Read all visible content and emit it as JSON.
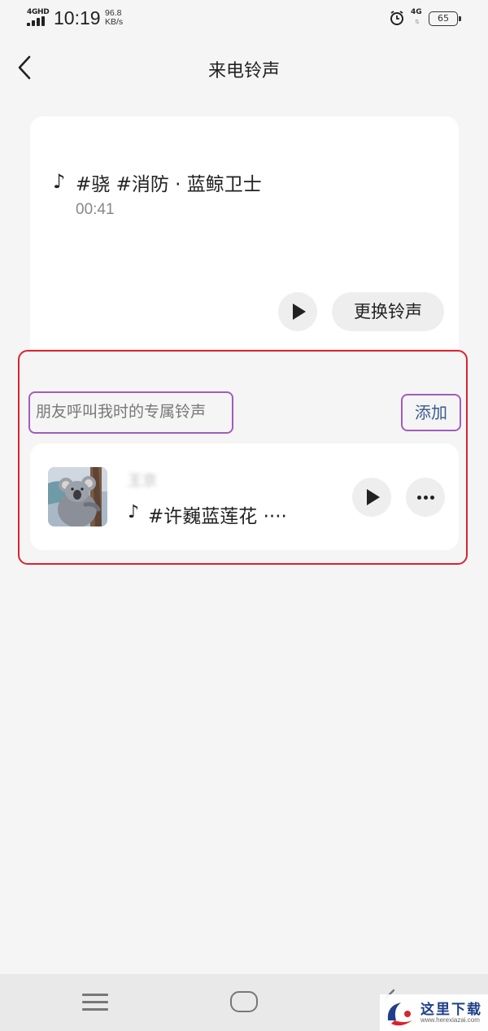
{
  "status_bar": {
    "signal_type": "4GHD",
    "time": "10:19",
    "net_speed_value": "96.8",
    "net_speed_unit": "KB/s",
    "network_right": "4G",
    "battery": "65"
  },
  "header": {
    "title": "来电铃声",
    "back_icon": "chevron-left-icon"
  },
  "current_ringtone": {
    "title": "#骁 #消防 · 蓝鲸卫士",
    "duration": "00:41",
    "change_button": "更换铃声",
    "note_icon": "♪"
  },
  "exclusive": {
    "section_label": "朋友呼叫我时的专属铃声",
    "add_label": "添加",
    "items": [
      {
        "contact_name": "王京",
        "song": "#许巍蓝莲花 ····",
        "note_icon": "♪",
        "cover_icon": "koala-icon"
      }
    ]
  },
  "watermark": {
    "text": "这里下载",
    "url": "www.herexiazai.com"
  },
  "colors": {
    "background": "#f5f5f5",
    "card": "#ffffff",
    "annotation_red": "#d9232d",
    "annotation_purple": "#a35bbd",
    "link_blue": "#3b5a8c"
  }
}
